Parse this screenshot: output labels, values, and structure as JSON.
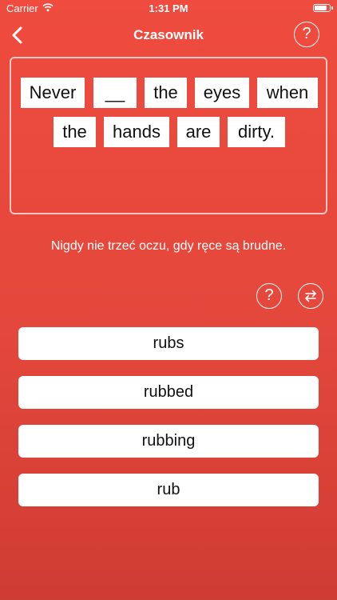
{
  "status_bar": {
    "carrier": "Carrier",
    "time": "1:31 PM",
    "battery_level": 0.85
  },
  "nav": {
    "title": "Czasownik",
    "help_label": "?"
  },
  "sentence": {
    "words": [
      "Never",
      "__",
      "the",
      "eyes",
      "when",
      "the",
      "hands",
      "are",
      "dirty."
    ]
  },
  "translation": "Nigdy nie trzeć oczu, gdy ręce są brudne.",
  "controls": {
    "hint_label": "?"
  },
  "answers": [
    "rubs",
    "rubbed",
    "rubbing",
    "rub"
  ],
  "colors": {
    "background": "#e4473b",
    "accent": "#ffffff"
  }
}
